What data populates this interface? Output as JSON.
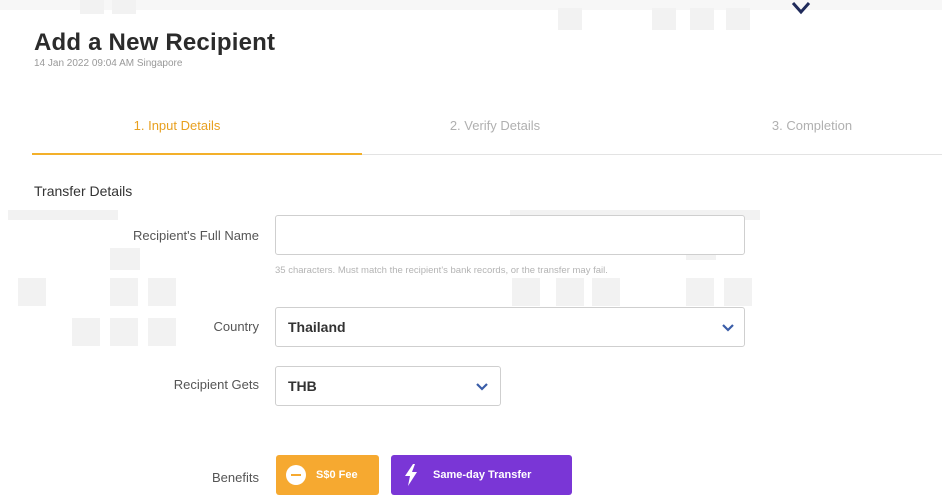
{
  "header": {
    "title": "Add a New Recipient",
    "timestamp": "14 Jan 2022 09:04 AM Singapore"
  },
  "steps": [
    {
      "label": "1. Input Details",
      "active": true
    },
    {
      "label": "2. Verify Details",
      "active": false
    },
    {
      "label": "3. Completion",
      "active": false
    }
  ],
  "section": {
    "title": "Transfer Details"
  },
  "form": {
    "full_name": {
      "label": "Recipient's Full Name",
      "value": "",
      "hint": "35 characters. Must match the recipient's bank records, or the transfer may fail."
    },
    "country": {
      "label": "Country",
      "value": "Thailand"
    },
    "recipient_gets": {
      "label": "Recipient Gets",
      "value": "THB"
    },
    "benefits": {
      "label": "Benefits",
      "items": [
        {
          "label": "S$0 Fee",
          "icon": "fee-icon",
          "color": "#f6a930"
        },
        {
          "label": "Same-day Transfer",
          "icon": "lightning-icon",
          "color": "#7a36d6"
        }
      ]
    }
  },
  "colors": {
    "accent": "#f3b02a",
    "step_active": "#e8a020",
    "purple": "#7a36d6"
  }
}
